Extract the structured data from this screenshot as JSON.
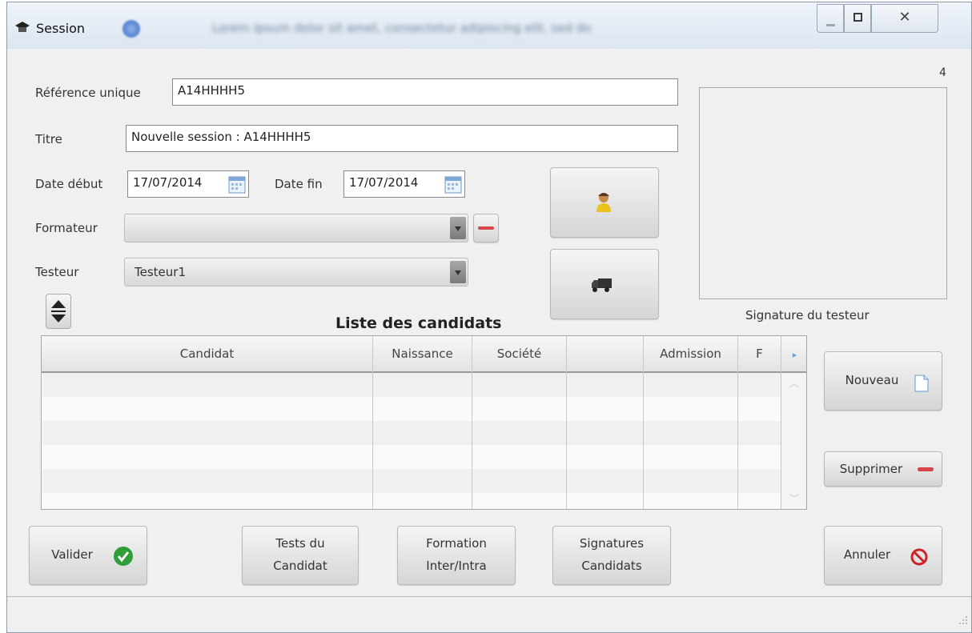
{
  "window": {
    "title": "Session",
    "title_blurred": "Lorem ipsum dolor sit amet, consectetur adipiscing elit, sed do",
    "record_number": "4"
  },
  "form": {
    "reference_label": "Référence unique",
    "reference_value": "A14HHHH5",
    "title_label": "Titre",
    "title_value": "Nouvelle session : A14HHHH5",
    "date_start_label": "Date début",
    "date_start_value": "17/07/2014",
    "date_end_label": "Date fin",
    "date_end_value": "17/07/2014",
    "formateur_label": "Formateur",
    "formateur_value": "",
    "testeur_label": "Testeur",
    "testeur_value": "Testeur1"
  },
  "signature": {
    "label": "Signature du testeur"
  },
  "candidates": {
    "title": "Liste des candidats",
    "columns": [
      "Candidat",
      "Naissance",
      "Société",
      "",
      "Admission",
      "F"
    ],
    "row_count": 6
  },
  "buttons": {
    "new": "Nouveau",
    "delete": "Supprimer",
    "validate": "Valider",
    "tests_line1": "Tests du",
    "tests_line2": "Candidat",
    "formation_line1": "Formation",
    "formation_line2": "Inter/Intra",
    "signatures_line1": "Signatures",
    "signatures_line2": "Candidats",
    "cancel": "Annuler"
  },
  "colors": {
    "delete_red": "#d9434a",
    "validate_green": "#2e9e3a",
    "cancel_red": "#d0202a"
  }
}
